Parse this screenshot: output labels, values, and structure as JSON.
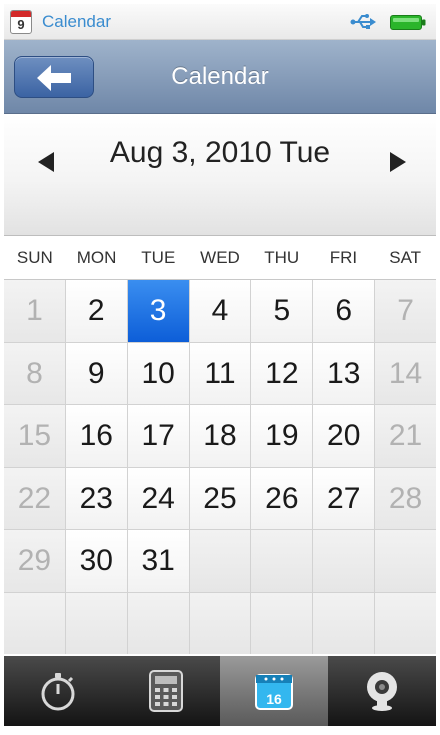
{
  "status_bar": {
    "app_icon_day": "9",
    "title": "Calendar",
    "icons": [
      "usb-icon",
      "battery-icon"
    ],
    "battery_color": "#2bb52b",
    "usb_color": "#3a8ccf"
  },
  "nav_bar": {
    "title": "Calendar",
    "back_icon": "back-arrow-icon"
  },
  "date_header": {
    "date": "Aug 3, 2010 Tue",
    "prev_icon": "prev-arrow-icon",
    "next_icon": "next-arrow-icon"
  },
  "weekdays": [
    "SUN",
    "MON",
    "TUE",
    "WED",
    "THU",
    "FRI",
    "SAT"
  ],
  "calendar": {
    "selected_day": "3",
    "weeks": [
      [
        "1",
        "2",
        "3",
        "4",
        "5",
        "6",
        "7"
      ],
      [
        "8",
        "9",
        "10",
        "11",
        "12",
        "13",
        "14"
      ],
      [
        "15",
        "16",
        "17",
        "18",
        "19",
        "20",
        "21"
      ],
      [
        "22",
        "23",
        "24",
        "25",
        "26",
        "27",
        "28"
      ],
      [
        "29",
        "30",
        "31",
        "",
        "",
        "",
        ""
      ],
      [
        "",
        "",
        "",
        "",
        "",
        "",
        ""
      ]
    ],
    "selected_color": "#1a6fe0"
  },
  "tab_bar": {
    "tabs": [
      {
        "icon": "stopwatch-icon",
        "active": false
      },
      {
        "icon": "calculator-icon",
        "active": false
      },
      {
        "icon": "calendar-icon",
        "active": true,
        "day": "16"
      },
      {
        "icon": "webcam-icon",
        "active": false
      }
    ]
  }
}
